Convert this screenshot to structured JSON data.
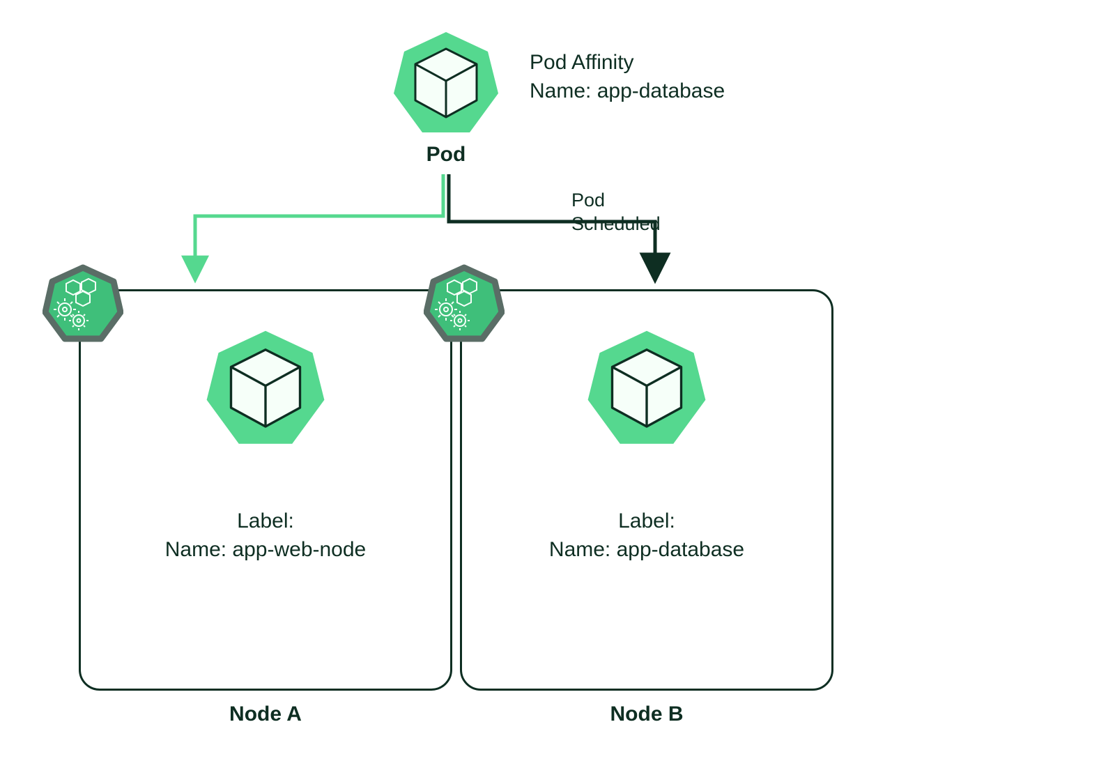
{
  "topPod": {
    "label": "Pod",
    "affinity_line1": "Pod Affinity",
    "affinity_line2": "Name: app-database"
  },
  "edge": {
    "scheduled_line1": "Pod",
    "scheduled_line2": "Scheduled"
  },
  "nodes": {
    "a": {
      "title": "Node A",
      "label_heading": "Label:",
      "label_value": "Name: app-web-node"
    },
    "b": {
      "title": "Node B",
      "label_heading": "Label:",
      "label_value": "Name: app-database"
    }
  },
  "colors": {
    "podFill": "#55d88f",
    "podStroke": "#0e2e22",
    "arrowLight": "#55d88f",
    "arrowDark": "#0e2e22",
    "badgeFill": "#3fbf7a",
    "badgeBorder": "#5a6d66"
  }
}
